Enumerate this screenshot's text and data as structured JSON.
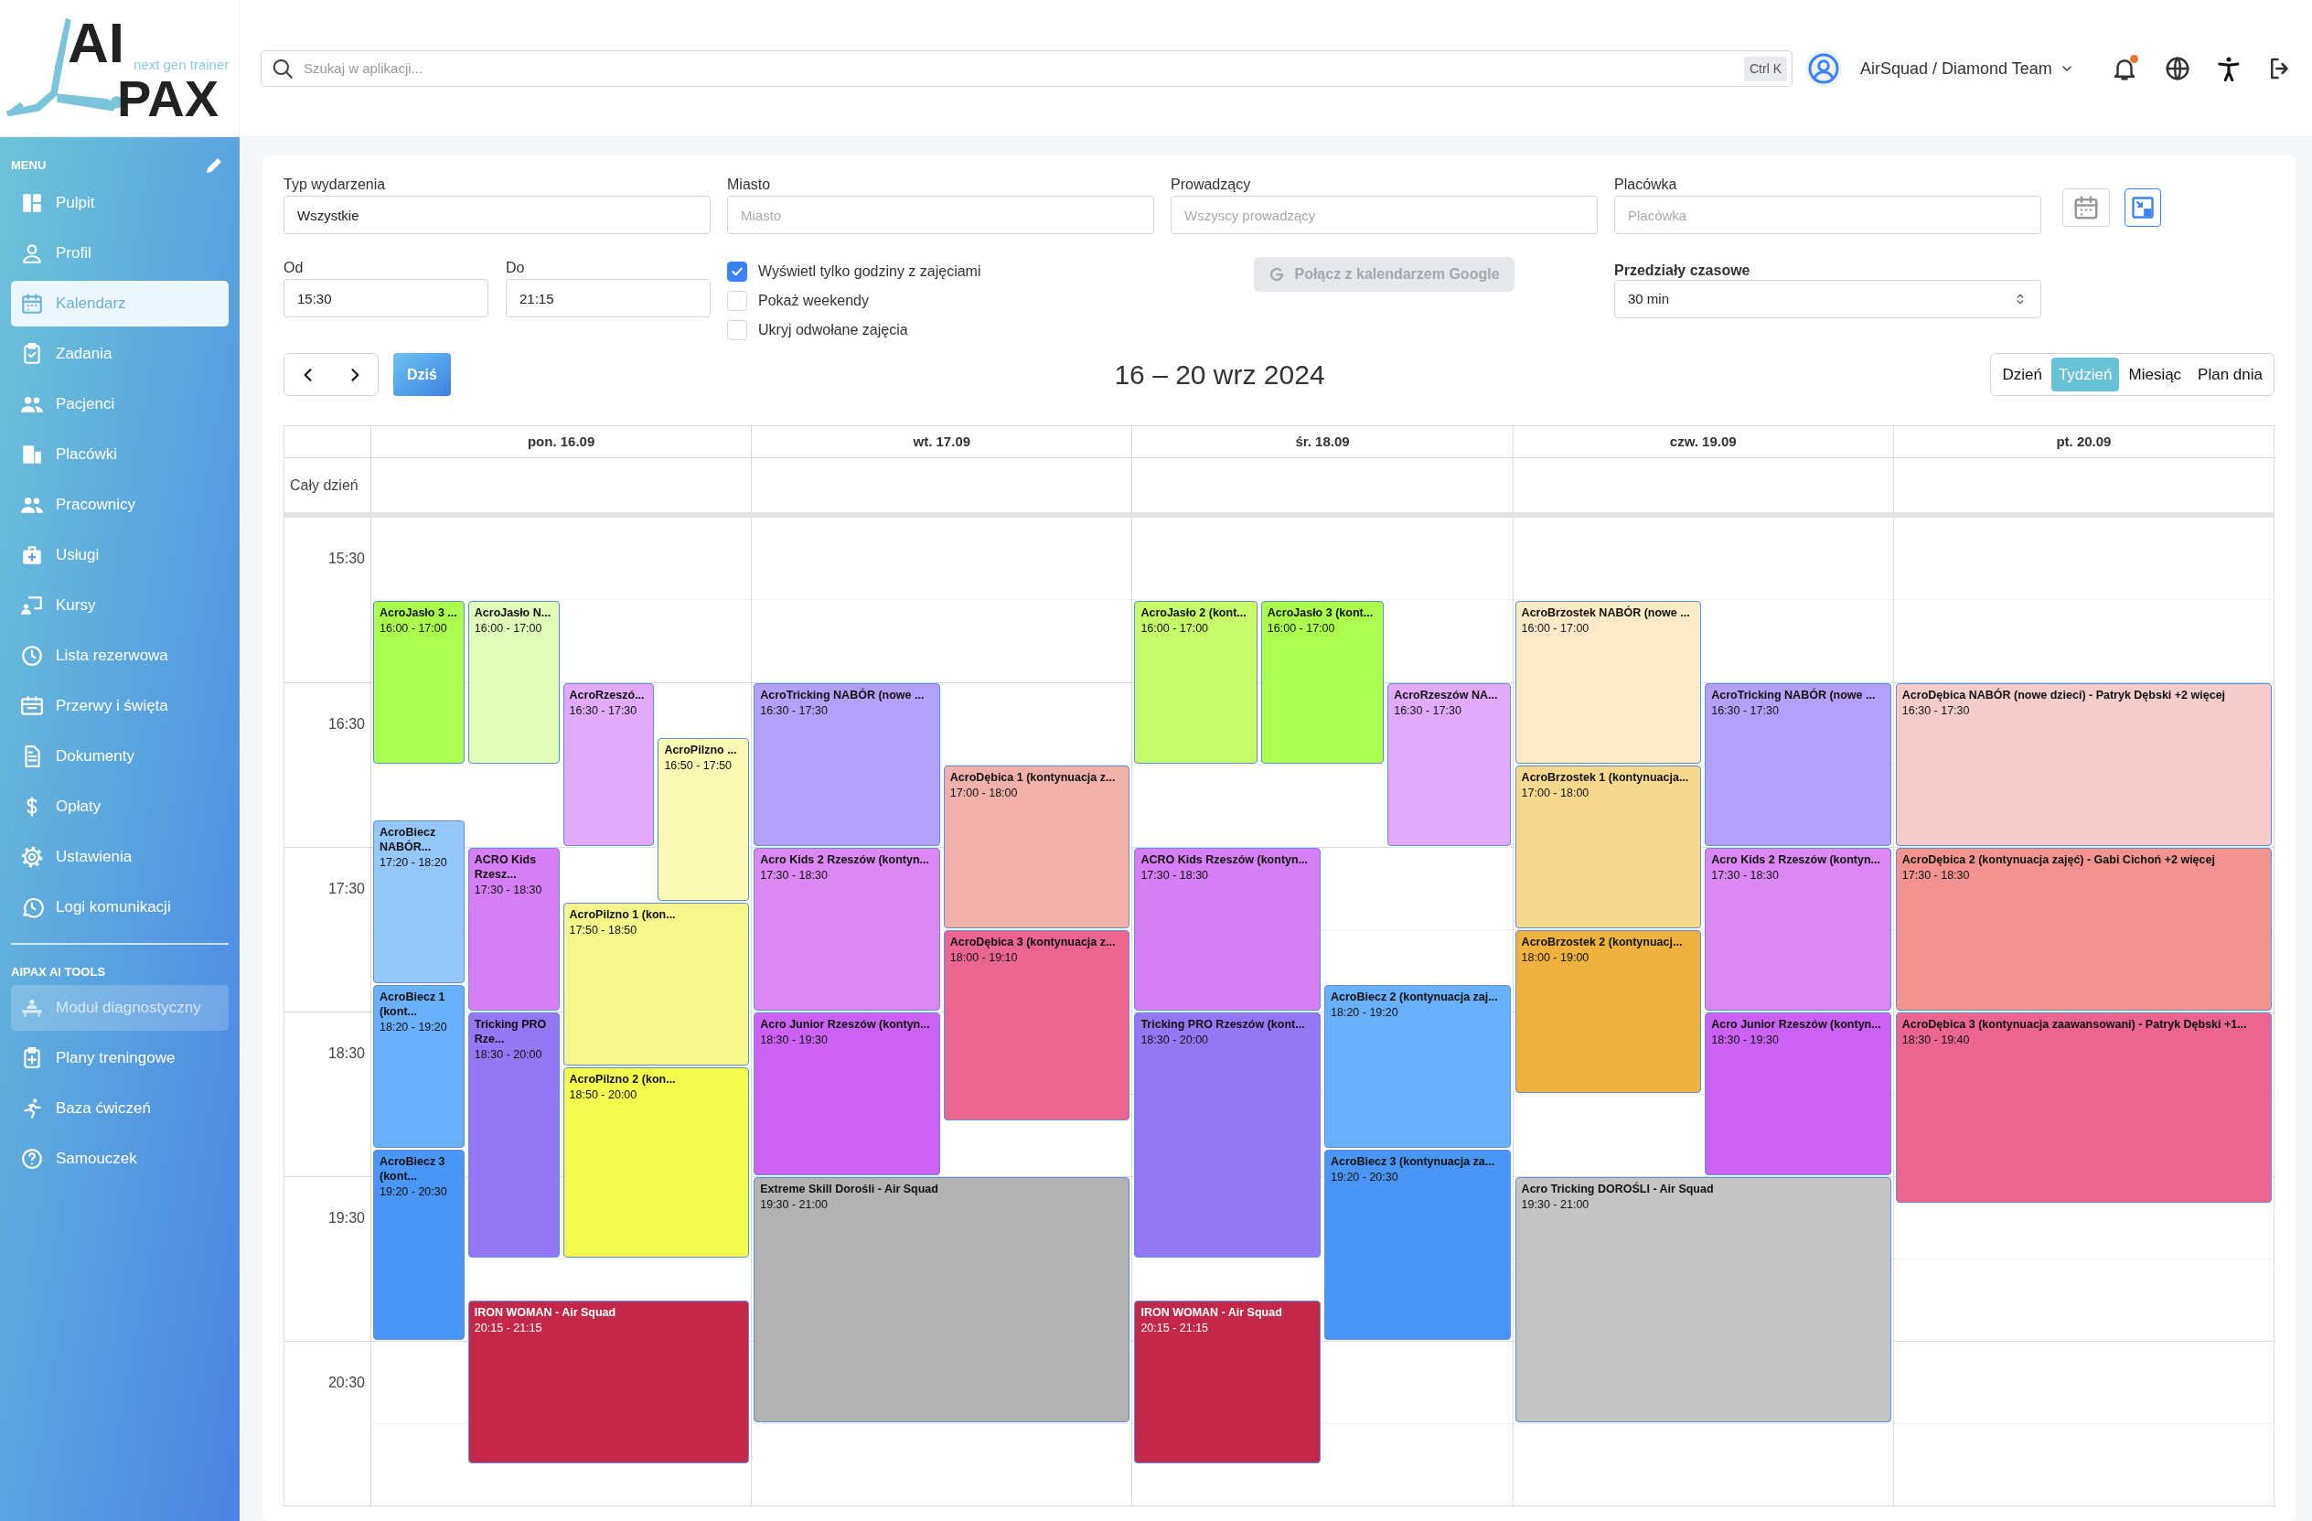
{
  "logo": {
    "mark": "AI",
    "tagline": "next gen trainer",
    "word": "PAX"
  },
  "search": {
    "placeholder": "Szukaj w aplikacji...",
    "shortcut": "Ctrl K"
  },
  "account": {
    "team": "AirSquad / Diamond Team"
  },
  "notifications": {
    "unread": true
  },
  "sidebar": {
    "menu_label": "MENU",
    "items": [
      {
        "label": "Pulpit",
        "selected": false
      },
      {
        "label": "Profil",
        "selected": false
      },
      {
        "label": "Kalendarz",
        "selected": true
      },
      {
        "label": "Zadania",
        "selected": false
      },
      {
        "label": "Pacjenci",
        "selected": false
      },
      {
        "label": "Placówki",
        "selected": false
      },
      {
        "label": "Pracownicy",
        "selected": false
      },
      {
        "label": "Usługi",
        "selected": false
      },
      {
        "label": "Kursy",
        "selected": false
      },
      {
        "label": "Lista rezerwowa",
        "selected": false
      },
      {
        "label": "Przerwy i święta",
        "selected": false
      },
      {
        "label": "Dokumenty",
        "selected": false
      },
      {
        "label": "Opłaty",
        "selected": false
      },
      {
        "label": "Ustawienia",
        "selected": false
      },
      {
        "label": "Logi komunikacji",
        "selected": false
      }
    ],
    "tools_label": "AIPAX AI TOOLS",
    "tools": [
      {
        "label": "Moduł diagnostyczny",
        "disabled": true
      },
      {
        "label": "Plany treningowe",
        "disabled": false
      },
      {
        "label": "Baza ćwiczeń",
        "disabled": false
      },
      {
        "label": "Samouczek",
        "disabled": false
      }
    ]
  },
  "filters": {
    "event_type": {
      "label": "Typ wydarzenia",
      "value": "Wszystkie"
    },
    "city": {
      "label": "Miasto",
      "placeholder": "Miasto"
    },
    "instructor": {
      "label": "Prowadzący",
      "placeholder": "Wszyscy prowadzący"
    },
    "facility": {
      "label": "Placówka",
      "placeholder": "Placówka"
    },
    "from": {
      "label": "Od",
      "value": "15:30"
    },
    "to": {
      "label": "Do",
      "value": "21:15"
    },
    "options": [
      {
        "label": "Wyświetl tylko godziny z zajęciami",
        "checked": true
      },
      {
        "label": "Pokaż weekendy",
        "checked": false
      },
      {
        "label": "Ukryj odwołane zajęcia",
        "checked": false
      }
    ],
    "google_button": {
      "label": "Połącz z kalendarzem Google",
      "disabled": true
    },
    "interval": {
      "label": "Przedziały czasowe",
      "value": "30 min"
    }
  },
  "toolbar": {
    "today": "Dziś",
    "range_title": "16 – 20 wrz 2024",
    "views": [
      {
        "label": "Dzień",
        "selected": false
      },
      {
        "label": "Tydzień",
        "selected": true
      },
      {
        "label": "Miesiąc",
        "selected": false
      },
      {
        "label": "Plan dnia",
        "selected": false
      }
    ]
  },
  "calendar": {
    "all_day_label": "Cały dzień",
    "time_labels": [
      "15:30",
      "16:30",
      "17:30",
      "18:30",
      "19:30",
      "20:30"
    ],
    "days": [
      {
        "label": "pon. 16.09",
        "events": [
          {
            "title": "AcroJasło 3 ...",
            "time": "16:00 - 17:00",
            "color": "#aaff4f"
          },
          {
            "title": "AcroJasło N...",
            "time": "16:00 - 17:00",
            "color": "#e2fcb9"
          },
          {
            "title": "AcroRzeszó...",
            "time": "16:30 - 17:30",
            "color": "#e2aafb"
          },
          {
            "title": "AcroPilzno ...",
            "time": "16:50 - 17:50",
            "color": "#fafab4"
          },
          {
            "title": "AcroBiecz NABÓR...",
            "time": "17:20 - 18:20",
            "color": "#95c8fa"
          },
          {
            "title": "ACRO Kids Rzesz...",
            "time": "17:30 - 18:30",
            "color": "#d67ef3"
          },
          {
            "title": "AcroPilzno 1 (kon...",
            "time": "17:50 - 18:50",
            "color": "#f5f78a"
          },
          {
            "title": "AcroBiecz 1 (kont...",
            "time": "18:20 - 19:20",
            "color": "#6aaff9"
          },
          {
            "title": "Tricking PRO Rze...",
            "time": "18:30 - 20:00",
            "color": "#9477f5"
          },
          {
            "title": "AcroPilzno 2 (kon...",
            "time": "18:50 - 20:00",
            "color": "#f2fc4e"
          },
          {
            "title": "AcroBiecz 3 (kont...",
            "time": "19:20 - 20:30",
            "color": "#4a95f5"
          },
          {
            "title": "IRON WOMAN - Air Squad",
            "time": "20:15 - 21:15",
            "color": "#c3284a"
          }
        ]
      },
      {
        "label": "wt. 17.09",
        "events": [
          {
            "title": "AcroTricking NABÓR (nowe ...",
            "time": "16:30 - 17:30",
            "color": "#b3a1f9"
          },
          {
            "title": "AcroDębica 1 (kontynuacja z...",
            "time": "17:00 - 18:00",
            "color": "#f1b0ac"
          },
          {
            "title": "Acro Kids 2 Rzeszów (kontyn...",
            "time": "17:30 - 18:30",
            "color": "#dc88f3"
          },
          {
            "title": "AcroDębica 3 (kontynuacja z...",
            "time": "18:00 - 19:10",
            "color": "#ea6690"
          },
          {
            "title": "Acro Junior Rzeszów (kontyn...",
            "time": "18:30 - 19:30",
            "color": "#cc62f3"
          },
          {
            "title": "Extreme Skill Dorośli - Air Squad",
            "time": "19:30 - 21:00",
            "color": "#b3b3b3"
          }
        ]
      },
      {
        "label": "śr. 18.09",
        "events": [
          {
            "title": "AcroJasło 2 (kont...",
            "time": "16:00 - 17:00",
            "color": "#c8fb6a"
          },
          {
            "title": "AcroJasło 3 (kont...",
            "time": "16:00 - 17:00",
            "color": "#aaff4f"
          },
          {
            "title": "AcroRzeszów NA...",
            "time": "16:30 - 17:30",
            "color": "#e2aafb"
          },
          {
            "title": "ACRO Kids Rzeszów (kontyn...",
            "time": "17:30 - 18:30",
            "color": "#d67ef3"
          },
          {
            "title": "AcroBiecz 2 (kontynuacja zaj...",
            "time": "18:20 - 19:20",
            "color": "#6aaff9"
          },
          {
            "title": "Tricking PRO Rzeszów (kont...",
            "time": "18:30 - 20:00",
            "color": "#9477f5"
          },
          {
            "title": "AcroBiecz 3 (kontynuacja za...",
            "time": "19:20 - 20:30",
            "color": "#4a95f5"
          },
          {
            "title": "IRON WOMAN - Air Squad",
            "time": "20:15 - 21:15",
            "color": "#c3284a"
          }
        ]
      },
      {
        "label": "czw. 19.09",
        "events": [
          {
            "title": "AcroBrzostek NABÓR (nowe ...",
            "time": "16:00 - 17:00",
            "color": "#fcebc6"
          },
          {
            "title": "AcroTricking NABÓR (nowe ...",
            "time": "16:30 - 17:30",
            "color": "#b3a1f9"
          },
          {
            "title": "AcroBrzostek 1 (kontynuacja...",
            "time": "17:00 - 18:00",
            "color": "#f8d78f"
          },
          {
            "title": "Acro Kids 2 Rzeszów (kontyn...",
            "time": "17:30 - 18:30",
            "color": "#dc88f3"
          },
          {
            "title": "AcroBrzostek 2 (kontynuacj...",
            "time": "18:00 - 19:00",
            "color": "#f0b23e"
          },
          {
            "title": "Acro Junior Rzeszów (kontyn...",
            "time": "18:30 - 19:30",
            "color": "#cc62f3"
          },
          {
            "title": "Acro Tricking DOROŚLI - Air Squad",
            "time": "19:30 - 21:00",
            "color": "#c4c4c4"
          }
        ]
      },
      {
        "label": "pt. 20.09",
        "events": [
          {
            "title": "AcroDębica NABÓR (nowe dzieci) - Patryk Dębski +2 więcej",
            "time": "16:30 - 17:30",
            "color": "#f6cccd"
          },
          {
            "title": "AcroDębica 2 (kontynuacja zajęć) - Gabi Cichoń +2 więcej",
            "time": "17:30 - 18:30",
            "color": "#f09391"
          },
          {
            "title": "AcroDębica 3 (kontynuacja zaawansowani) - Patryk Dębski +1...",
            "time": "18:30 - 19:40",
            "color": "#ea6690"
          }
        ]
      }
    ]
  }
}
